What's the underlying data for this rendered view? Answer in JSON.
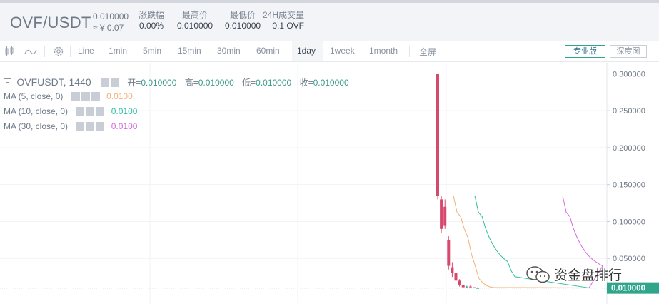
{
  "ticker": {
    "pair": "OVF/USDT",
    "last_price": "0.010000",
    "approx_cny": "≈ ¥ 0.07",
    "stats": [
      {
        "label": "涨跌幅",
        "value": "0.00%"
      },
      {
        "label": "最高价",
        "value": "0.010000"
      },
      {
        "label": "最低价",
        "value": "0.010000"
      },
      {
        "label": "24H成交量",
        "value": "0.1 OVF"
      }
    ]
  },
  "toolbar": {
    "intervals": [
      "Line",
      "1min",
      "5min",
      "15min",
      "30min",
      "60min",
      "1day",
      "1week",
      "1month"
    ],
    "active_interval": "1day",
    "fullscreen": "全屏",
    "pro_label": "专业版",
    "depth_label": "深度图"
  },
  "legend": {
    "symbol": "OVFUSDT, 1440",
    "open_k": "开=",
    "open_v": "0.010000",
    "high_k": "高=",
    "high_v": "0.010000",
    "low_k": "低=",
    "low_v": "0.010000",
    "close_k": "收=",
    "close_v": "0.010000",
    "ma": [
      {
        "label": "MA (5, close, 0)",
        "value": "0.0100",
        "color": "#f0b27a"
      },
      {
        "label": "MA (10, close, 0)",
        "value": "0.0100",
        "color": "#2fbf9f"
      },
      {
        "label": "MA (30, close, 0)",
        "value": "0.0100",
        "color": "#d36cdf"
      }
    ]
  },
  "watermark": "资金盘排行",
  "chart_data": {
    "type": "candlestick",
    "y_ticks": [
      "0.300000",
      "0.250000",
      "0.200000",
      "0.150000",
      "0.100000",
      "0.050000"
    ],
    "ylim": [
      0.0,
      0.31
    ],
    "last_value_label": "0.010000",
    "colors": {
      "down": "#d6496c",
      "up": "#2fa58c",
      "ma5": "#f0b27a",
      "ma10": "#2fbf9f",
      "ma30": "#d36cdf"
    },
    "candles": [
      {
        "open": 0.3,
        "high": 0.3,
        "low": 0.13,
        "close": 0.135
      },
      {
        "open": 0.13,
        "high": 0.135,
        "low": 0.085,
        "close": 0.09
      },
      {
        "open": 0.12,
        "high": 0.13,
        "low": 0.09,
        "close": 0.095
      },
      {
        "open": 0.075,
        "high": 0.08,
        "low": 0.035,
        "close": 0.04
      },
      {
        "open": 0.038,
        "high": 0.045,
        "low": 0.025,
        "close": 0.03
      },
      {
        "open": 0.03,
        "high": 0.033,
        "low": 0.018,
        "close": 0.02
      },
      {
        "open": 0.02,
        "high": 0.022,
        "low": 0.012,
        "close": 0.014
      },
      {
        "open": 0.014,
        "high": 0.015,
        "low": 0.01,
        "close": 0.011
      },
      {
        "open": 0.011,
        "high": 0.013,
        "low": 0.01,
        "close": 0.012
      },
      {
        "open": 0.012,
        "high": 0.014,
        "low": 0.01,
        "close": 0.011
      },
      {
        "open": 0.011,
        "high": 0.011,
        "low": 0.01,
        "close": 0.01
      },
      {
        "open": 0.01,
        "high": 0.011,
        "low": 0.01,
        "close": 0.01
      }
    ]
  }
}
